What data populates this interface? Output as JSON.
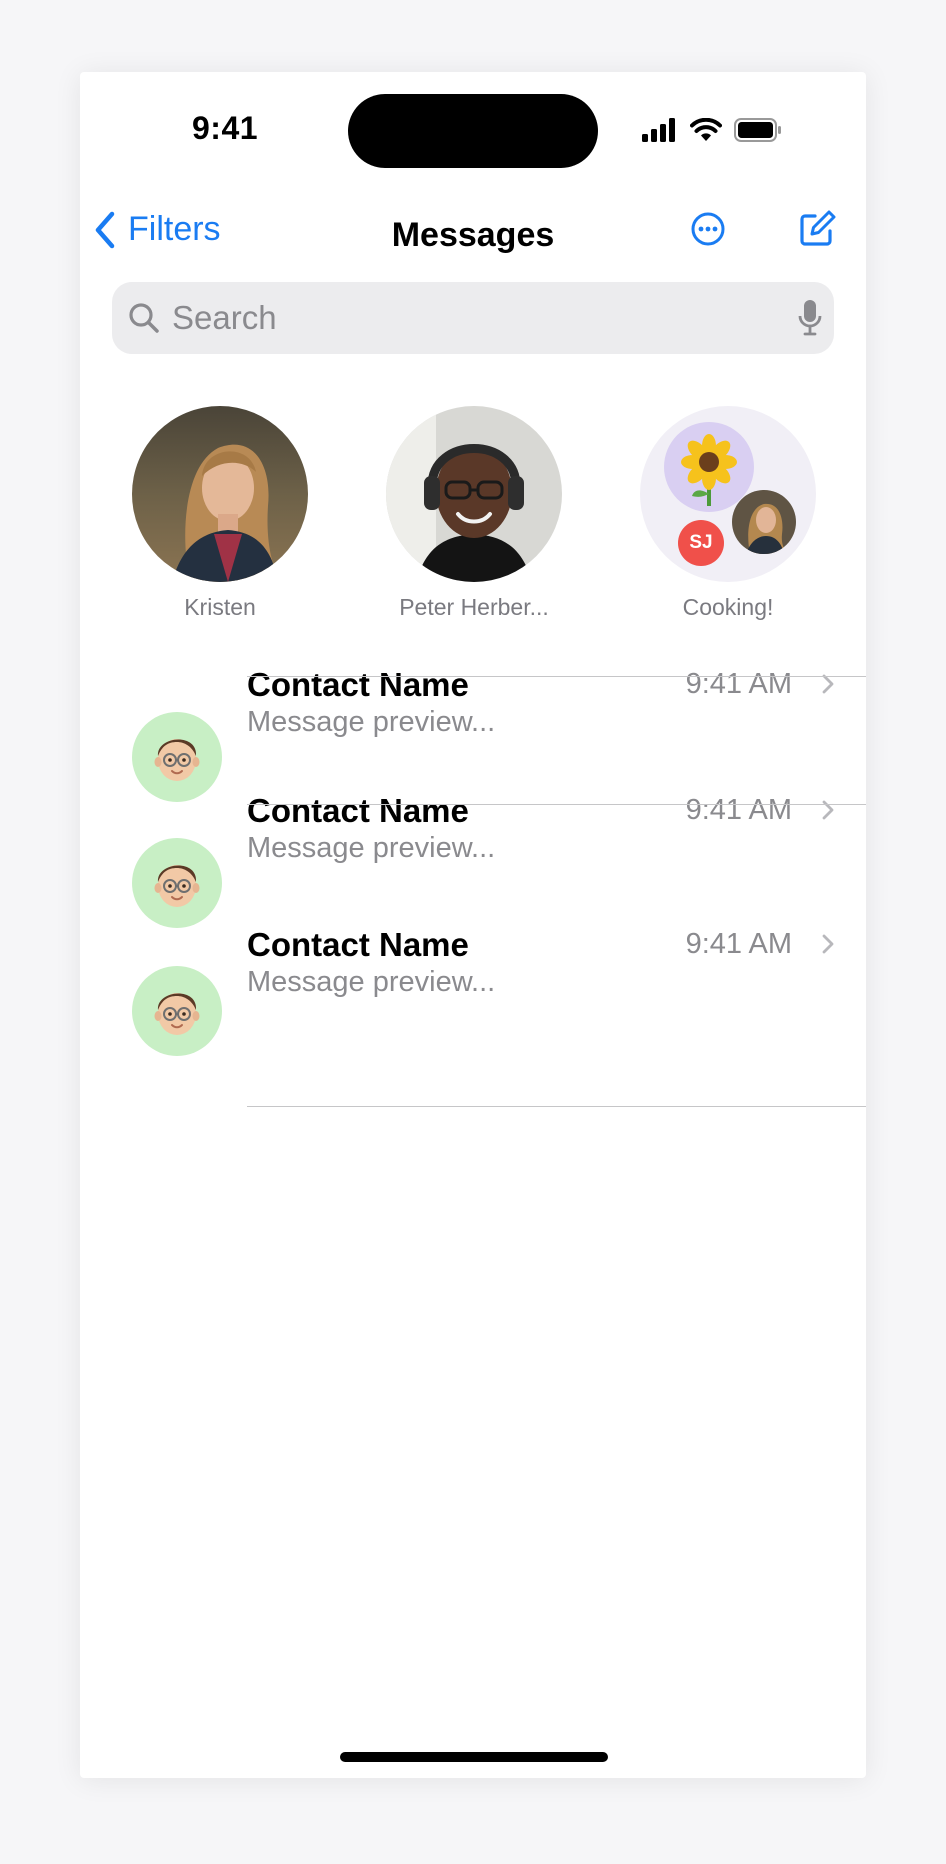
{
  "status_bar": {
    "time": "9:41"
  },
  "nav": {
    "back_label": "Filters",
    "title": "Messages"
  },
  "search": {
    "placeholder": "Search"
  },
  "pinned": [
    {
      "name": "Kristen"
    },
    {
      "name": "Peter Herber..."
    },
    {
      "name": "Cooking!",
      "initials": "SJ"
    }
  ],
  "conversations": [
    {
      "name": "Contact Name",
      "preview": "Message preview...",
      "time": "9:41 AM"
    },
    {
      "name": "Contact Name",
      "preview": "Message preview...",
      "time": "9:41 AM"
    },
    {
      "name": "Contact Name",
      "preview": "Message preview...",
      "time": "9:41 AM"
    }
  ],
  "colors": {
    "accent": "#1a7cf2",
    "memoji_bg": "#c8efc5",
    "group_bg": "#f1eff6",
    "sunflower_bg": "#d9cff2",
    "sj_badge": "#f0504a"
  }
}
